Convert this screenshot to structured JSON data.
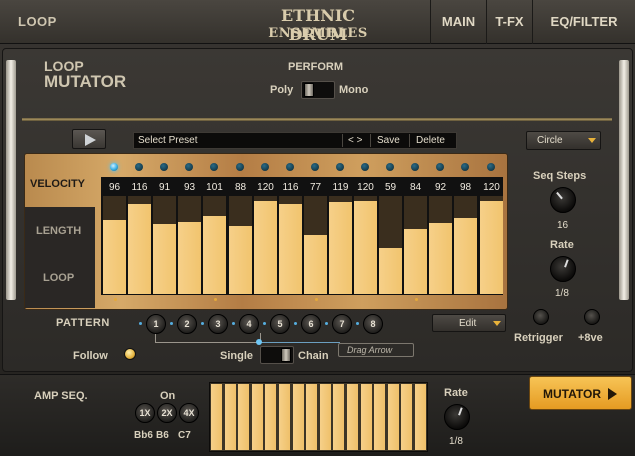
{
  "header": {
    "section": "LOOP",
    "title_line1": "ETHNIC DRUM",
    "title_line2": "ENSEMBLES",
    "tabs": [
      "MAIN",
      "T-FX",
      "EQ/FILTER"
    ]
  },
  "loop_mutator": {
    "title_line1": "LOOP",
    "title_line2": "MUTATOR",
    "perform_label": "PERFORM",
    "poly_label": "Poly",
    "mono_label": "Mono"
  },
  "preset": {
    "name": "Select Preset",
    "nav": "< >",
    "save": "Save",
    "delete": "Delete"
  },
  "mode_dropdown": "Circle",
  "sequencer": {
    "labels": {
      "velocity": "VELOCITY",
      "length": "LENGTH",
      "loop": "LOOP"
    },
    "velocities": [
      96,
      116,
      91,
      93,
      101,
      88,
      120,
      116,
      77,
      119,
      120,
      59,
      84,
      92,
      98,
      120
    ],
    "velocity_max": 127,
    "active_step": 1,
    "loop_markers": [
      1,
      5,
      9,
      13
    ]
  },
  "seq_steps": {
    "label": "Seq Steps",
    "value": "16"
  },
  "rate": {
    "label": "Rate",
    "value": "1/8"
  },
  "retrigger_label": "Retrigger",
  "octave_label": "+8ve",
  "pattern": {
    "label": "PATTERN",
    "buttons": [
      "1",
      "2",
      "3",
      "4",
      "5",
      "6",
      "7",
      "8"
    ],
    "edit": "Edit"
  },
  "follow_label": "Follow",
  "single_label": "Single",
  "chain_label": "Chain",
  "drag_arrow": "Drag Arrow",
  "amp_seq": {
    "label": "AMP SEQ.",
    "on_label": "On",
    "buttons": [
      "1X",
      "2X",
      "4X"
    ],
    "notes": [
      "Bb6",
      "B6",
      "C7"
    ],
    "steps": 16,
    "rate_label": "Rate",
    "rate_value": "1/8"
  },
  "mutator_button": "MUTATOR",
  "colors": {
    "accent": "#f0b83e",
    "bar": "#f4cd84",
    "led": "#3fb4ea"
  }
}
